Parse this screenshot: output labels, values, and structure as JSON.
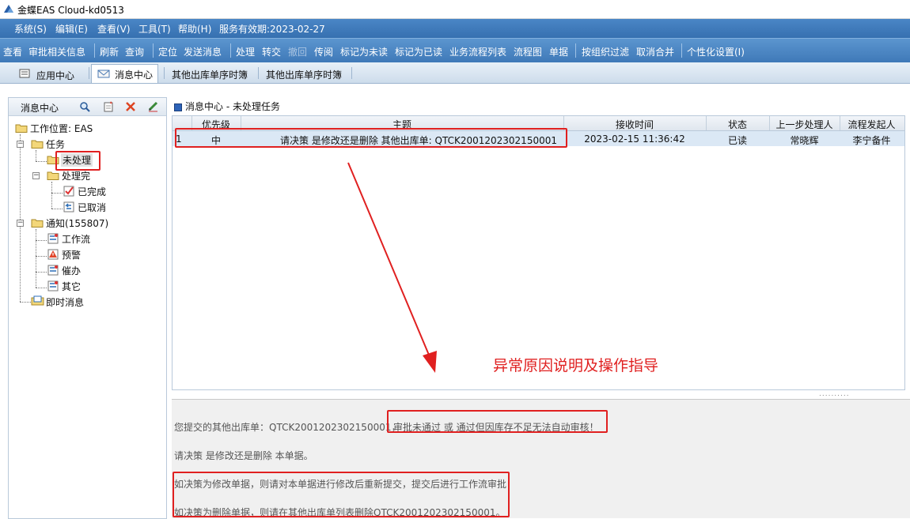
{
  "window": {
    "title": "金蝶EAS Cloud-kd0513"
  },
  "menubar": {
    "items": [
      "系统(S)",
      "编辑(E)",
      "查看(V)",
      "工具(T)",
      "帮助(H)",
      "服务有效期:2023-02-27"
    ]
  },
  "toolbar": {
    "items": [
      "查看",
      "审批相关信息",
      "刷新",
      "查询",
      "定位",
      "发送消息",
      "处理",
      "转交",
      "撤回",
      "传阅",
      "标记为未读",
      "标记为已读",
      "业务流程列表",
      "流程图",
      "单据",
      "按组织过滤",
      "取消合并",
      "个性化设置(I)"
    ]
  },
  "tabs": [
    "应用中心",
    "消息中心",
    "其他出库单序时簿",
    "其他出库单序时簿"
  ],
  "left_panel": {
    "title": "消息中心",
    "tree": {
      "root": "工作位置: EAS",
      "task": "任务",
      "pending": "未处理",
      "processed": "处理完",
      "completed": "已完成",
      "cancelled": "已取消",
      "notice": "通知(155807)",
      "workflow": "工作流",
      "warning": "预警",
      "urge": "催办",
      "other": "其它",
      "instant": "即时消息"
    }
  },
  "main": {
    "title": "消息中心 - 未处理任务",
    "columns": [
      "优先级",
      "主题",
      "接收时间",
      "状态",
      "上一步处理人",
      "流程发起人"
    ],
    "rows": [
      {
        "index": "1",
        "priority": "中",
        "subject": "请决策 是修改还是删除 其他出库单: QTCK2001202302150001",
        "time": "2023-02-15 11:36:42",
        "status": "已读",
        "prev_handler": "常晓辉",
        "initiator": "李宁备件"
      }
    ]
  },
  "annotation": {
    "text": "异常原因说明及操作指导",
    "color": "#e02020"
  },
  "detail": {
    "line1_prefix": "您提交的其他出库单：QTCK2001202302150001，",
    "line1_reason": "审批未通过 或 通过但因库存不足无法自动审核！",
    "line2": "请决策 是修改还是删除 本单据。",
    "line3": "如决策为修改单据，则请对本单据进行修改后重新提交，提交后进行工作流审批",
    "line4": "如决策为删除单据，则请在其他出库单列表删除QTCK2001202302150001。"
  },
  "colors": {
    "menu_bg": "#3f7cbd",
    "highlight": "#e02020",
    "row_selected": "#dbe8f5"
  }
}
